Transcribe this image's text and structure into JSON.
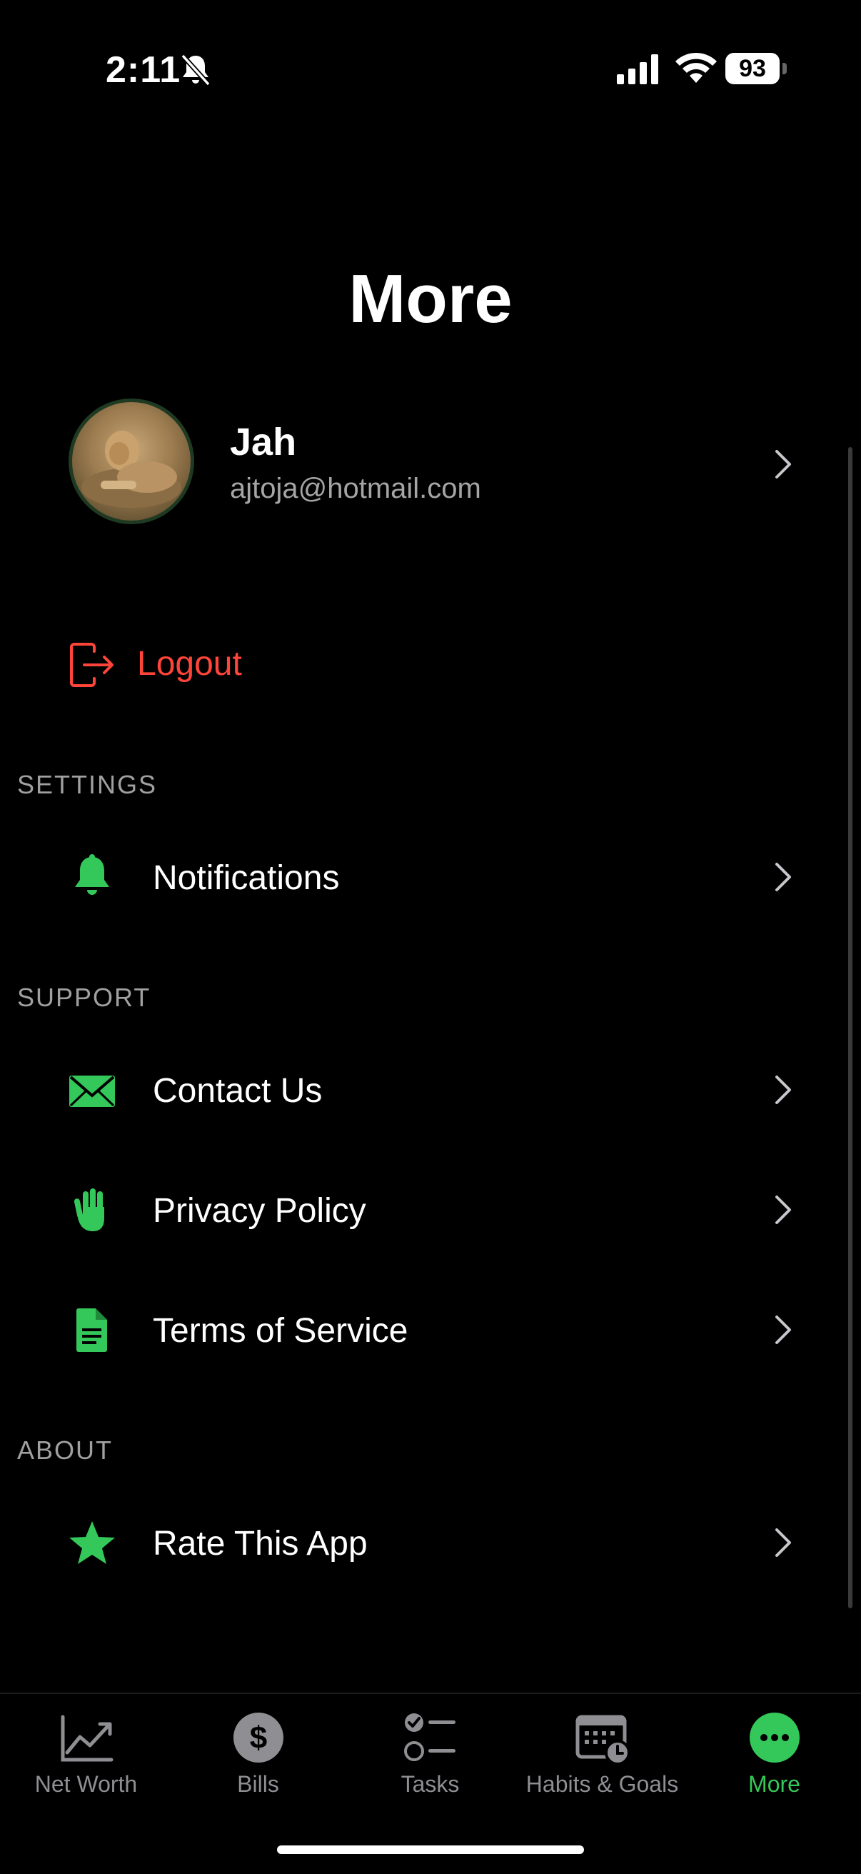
{
  "status_bar": {
    "time": "2:11",
    "battery": "93"
  },
  "page": {
    "title": "More"
  },
  "profile": {
    "name": "Jah",
    "email": "ajtoja@hotmail.com"
  },
  "logout": {
    "label": "Logout"
  },
  "sections": {
    "settings": "SETTINGS",
    "support": "SUPPORT",
    "about": "ABOUT"
  },
  "rows": {
    "notifications": "Notifications",
    "contact_us": "Contact Us",
    "privacy_policy": "Privacy Policy",
    "terms_of_service": "Terms of Service",
    "rate_this_app": "Rate This App"
  },
  "icons": {
    "notifications": "bell-icon",
    "contact_us": "envelope-icon",
    "privacy_policy": "hand-icon",
    "terms_of_service": "document-icon",
    "rate_this_app": "star-icon",
    "logout": "logout-icon"
  },
  "tabs": [
    {
      "label": "Net Worth",
      "icon": "chart-line-icon",
      "active": false
    },
    {
      "label": "Bills",
      "icon": "dollar-circle-icon",
      "active": false
    },
    {
      "label": "Tasks",
      "icon": "checklist-icon",
      "active": false
    },
    {
      "label": "Habits & Goals",
      "icon": "calendar-clock-icon",
      "active": false
    },
    {
      "label": "More",
      "icon": "more-dots-icon",
      "active": true
    }
  ],
  "colors": {
    "accent": "#34c759",
    "destructive": "#ff453a",
    "background": "#000000",
    "secondary_text": "#a5a5a5"
  }
}
